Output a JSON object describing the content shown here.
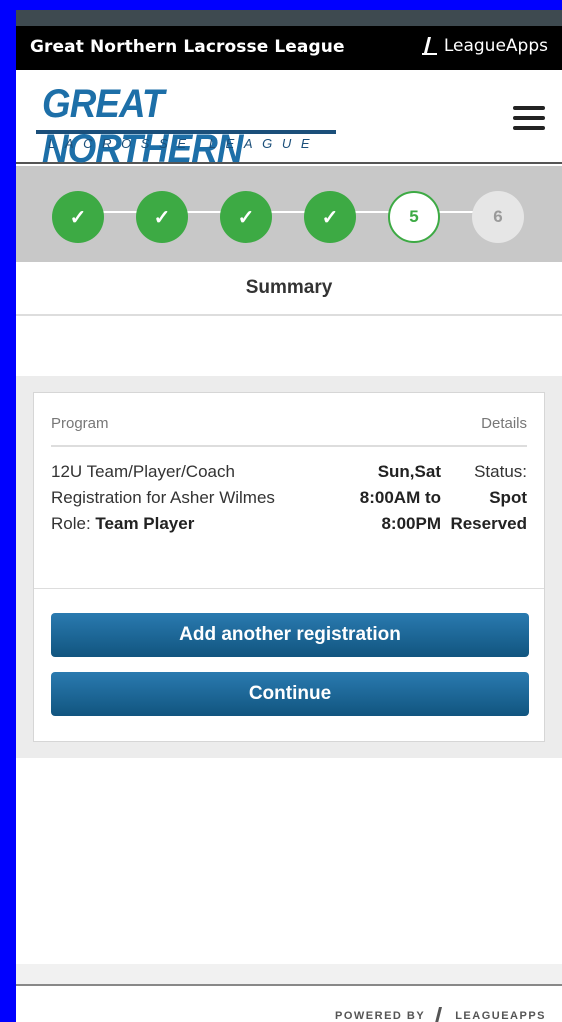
{
  "header": {
    "league_name": "Great Northern Lacrosse League",
    "brand": "LeagueApps"
  },
  "logo": {
    "line1": "GREAT NORTHERN",
    "line2": "LACROSSE LEAGUE"
  },
  "steps": [
    {
      "label": "✓",
      "state": "done"
    },
    {
      "label": "✓",
      "state": "done"
    },
    {
      "label": "✓",
      "state": "done"
    },
    {
      "label": "✓",
      "state": "done"
    },
    {
      "label": "5",
      "state": "current"
    },
    {
      "label": "6",
      "state": "next"
    }
  ],
  "summary": {
    "title": "Summary"
  },
  "table": {
    "col_program": "Program",
    "col_details": "Details",
    "program_text": "12U Team/Player/Coach Registration for Asher Wilmes",
    "role_label": "Role: ",
    "role_value": "Team Player",
    "days": "Sun,Sat",
    "time_line1": "8:00AM to",
    "time_line2": "8:00PM",
    "status_label": "Status:",
    "status_line1": "Spot",
    "status_line2": "Reserved"
  },
  "buttons": {
    "add_registration": "Add another registration",
    "continue": "Continue"
  },
  "footer": {
    "powered_by": "POWERED BY",
    "brand": "LEAGUEAPPS"
  },
  "colors": {
    "accent_green": "#3daa44",
    "button_blue": "#1d6a9a",
    "logo_blue": "#1d6fa8"
  }
}
